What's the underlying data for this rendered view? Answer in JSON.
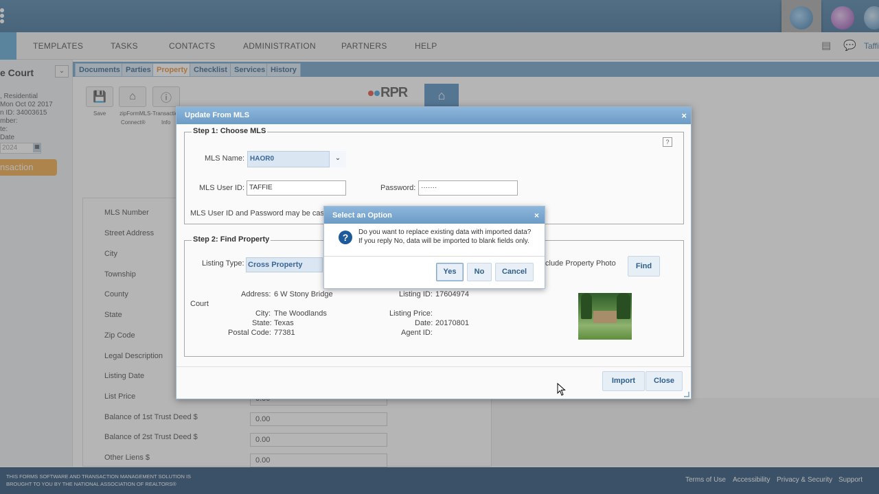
{
  "nav": {
    "items": [
      "TEMPLATES",
      "TASKS",
      "CONTACTS",
      "ADMINISTRATION",
      "PARTNERS",
      "HELP"
    ],
    "user": "Taffi"
  },
  "left": {
    "title": "e Court",
    "meta": [
      ", Residential",
      "Mon Oct 02 2017",
      "n ID: 34003615",
      "mber:",
      "te:",
      "Date"
    ],
    "date_value": "2024",
    "transaction_btn": "nsaction"
  },
  "tabs": [
    "Documents",
    "Parties",
    "Property",
    "Checklist",
    "Services",
    "History"
  ],
  "toolbar": {
    "save": "Save",
    "zipform_line1": "zipFormMLS-",
    "zipform_line2": "Connect®",
    "transaction_line1": "Transaction",
    "transaction_line2": "Info"
  },
  "rpr": {
    "logo": "RPR"
  },
  "form": {
    "labels": [
      "MLS Number",
      "Street Address",
      "City",
      "Township",
      "County",
      "State",
      "Zip Code",
      "Legal Description",
      "Listing Date",
      "List Price",
      "Balance of 1st Trust Deed $",
      "Balance of 2st Trust Deed $",
      "Other Liens $"
    ],
    "values": {
      "list_price": "0.00",
      "trust1": "0.00",
      "trust2": "0.00",
      "other_liens": "0.00"
    }
  },
  "modal": {
    "title": "Update From MLS",
    "close": "×",
    "help": "?",
    "step1": {
      "legend": "Step 1: Choose MLS",
      "mls_name_label": "MLS Name:",
      "mls_name_value": "HAOR0",
      "user_id_label": "MLS User ID:",
      "user_id_value": "TAFFIE",
      "password_label": "Password:",
      "password_value": "·······",
      "note": "MLS User ID and Password may be cas"
    },
    "step2": {
      "legend": "Step 2: Find Property",
      "listing_type_label": "Listing Type:",
      "listing_type_value": "Cross Property",
      "photo_label": "clude Property Photo",
      "find_btn": "Find",
      "court": "Court",
      "address_label": "Address:",
      "address_value": "6 W Stony Bridge",
      "city_label": "City:",
      "city_value": "The Woodlands",
      "state_label": "State:",
      "state_value": "Texas",
      "postal_label": "Postal Code:",
      "postal_value": "77381",
      "listing_id_label": "Listing ID:",
      "listing_id_value": "17604974",
      "listing_price_label": "Listing Price:",
      "date_label": "Date:",
      "date_value": "20170801",
      "agent_id_label": "Agent ID:"
    },
    "import_btn": "Import",
    "close_btn": "Close"
  },
  "dialog": {
    "title": "Select an Option",
    "close": "×",
    "line1": "Do you want to replace existing data with imported data?",
    "line2": "If you reply No, data will be imported to blank fields only.",
    "yes": "Yes",
    "no": "No",
    "cancel": "Cancel"
  },
  "footer": {
    "line1": "THIS FORMS SOFTWARE AND TRANSACTION MANAGEMENT SOLUTION IS",
    "line2": "BROUGHT TO YOU BY THE NATIONAL ASSOCIATION OF REALTORS®",
    "links": [
      "Terms of Use",
      "Accessibility",
      "Privacy & Security",
      "Support"
    ]
  },
  "colors": {
    "header_blue": "#3b6d95",
    "accent_orange": "#f0a640",
    "footer_navy": "#1f4a72",
    "dialog_header": "#7aa8d2"
  }
}
